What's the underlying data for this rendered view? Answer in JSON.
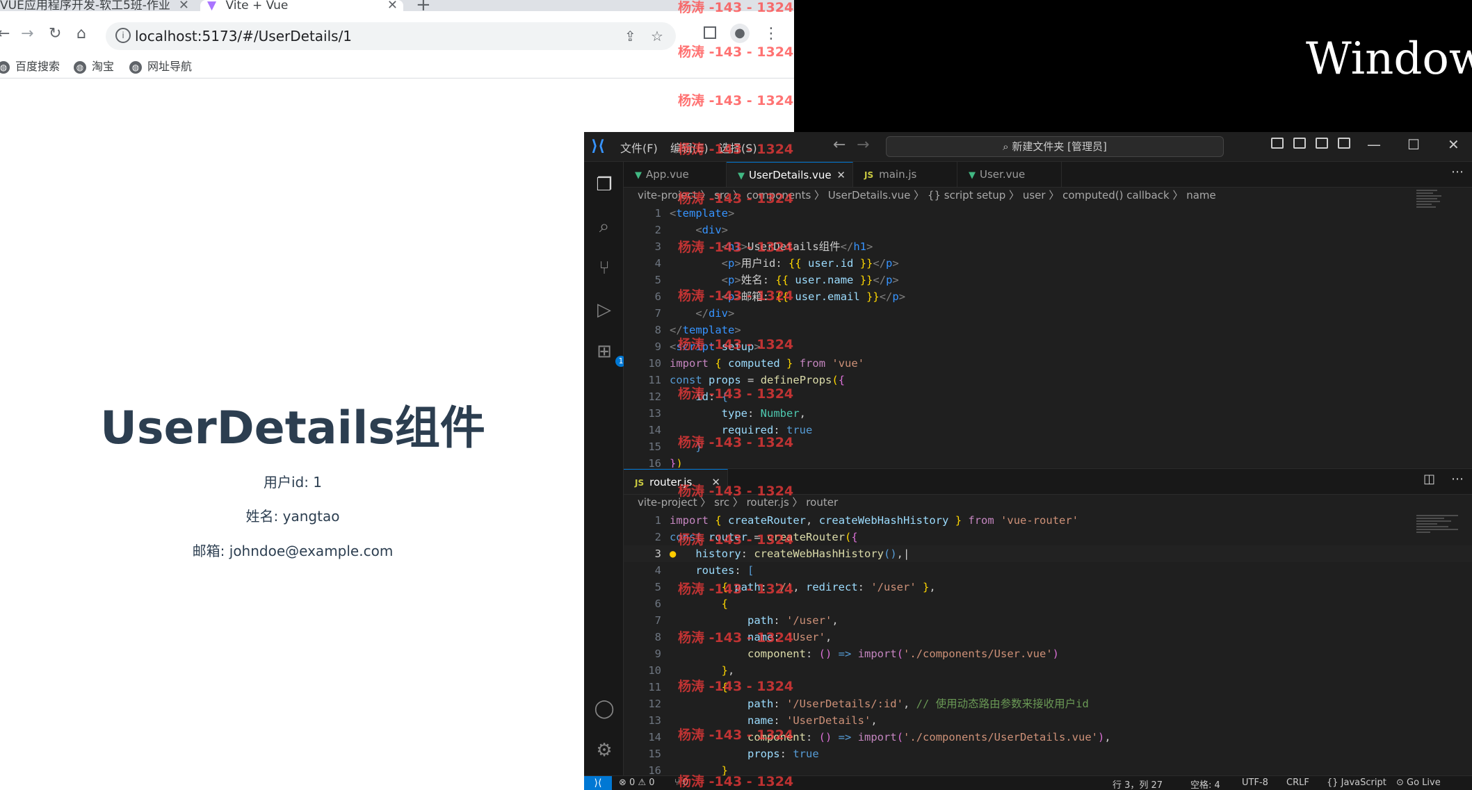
{
  "browser": {
    "tabs": [
      {
        "title": "VUE应用程序开发-软工5班-作业",
        "close": "✕"
      },
      {
        "title": "Vite + Vue",
        "close": "✕"
      }
    ],
    "new_tab": "+",
    "url": "localhost:5173/#/UserDetails/1",
    "bookmarks": [
      "百度搜索",
      "淘宝",
      "网址导航"
    ]
  },
  "page": {
    "title": "UserDetails组件",
    "lines": [
      "用户id: 1",
      "姓名: yangtao",
      "邮箱: johndoe@example.com"
    ]
  },
  "desktop": {
    "text": "Window"
  },
  "watermark": "杨涛 -143 - 1324",
  "vscode": {
    "menus": [
      "文件(F)",
      "编辑(E)",
      "选择(S)"
    ],
    "command_center": "新建文件夹 [管理员]",
    "extensions_badge": "1",
    "group1": {
      "tabs": [
        "App.vue",
        "UserDetails.vue",
        "main.js",
        "User.vue"
      ],
      "tab_close": "✕",
      "breadcrumbs": "vite-project 〉 src 〉 components 〉 UserDetails.vue 〉 {} script setup 〉 user 〉 computed() callback 〉 name",
      "line_numbers": [
        "1",
        "2",
        "3",
        "4",
        "5",
        "6",
        "7",
        "8",
        "9",
        "10",
        "11",
        "12",
        "13",
        "14",
        "15",
        "16"
      ]
    },
    "group2": {
      "tab": "router.js",
      "tab_close": "✕",
      "breadcrumbs": "vite-project 〉 src 〉 router.js 〉 router",
      "line_numbers": [
        "1",
        "2",
        "3",
        "4",
        "5",
        "6",
        "7",
        "8",
        "9",
        "10",
        "11",
        "12",
        "13",
        "14",
        "15",
        "16"
      ]
    },
    "status": {
      "problems": "⊗ 0 ⚠ 0",
      "ports": "⑂ 0",
      "position": "行 3，列 27",
      "spaces": "空格: 4",
      "encoding": "UTF-8",
      "eol": "CRLF",
      "language": "{} JavaScript",
      "golive": "⊙ Go Live"
    }
  }
}
